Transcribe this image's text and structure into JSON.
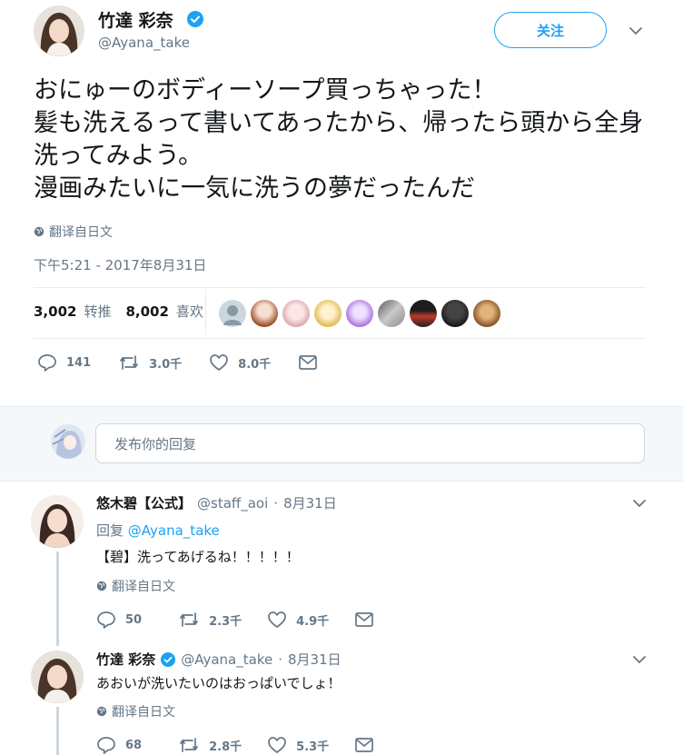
{
  "main_tweet": {
    "author_name": "竹達 彩奈",
    "author_handle": "@Ayana_take",
    "follow_label": "关注",
    "text_lines": [
      "おにゅーのボディーソープ買っちゃった！",
      "髪も洗えるって書いてあったから、帰ったら頭から全身",
      "洗ってみよう。",
      "漫画みたいに一気に洗うの夢だったんだ"
    ],
    "translate_label": "翻译自日文",
    "timestamp": "下午5:21 - 2017年8月31日",
    "retweet_count": "3,002",
    "retweet_label": "转推",
    "like_count": "8,002",
    "like_label": "喜欢",
    "actions": {
      "reply_count": "141",
      "retweet_count": "3.0千",
      "like_count": "8.0千"
    }
  },
  "composer": {
    "placeholder": "发布你的回复"
  },
  "replies": [
    {
      "author_name": "悠木碧【公式】",
      "author_handle": "@staff_aoi",
      "separator": "·",
      "date": "8月31日",
      "reply_to_label": "回复",
      "reply_to_handle": "@Ayana_take",
      "text": "【碧】洗ってあげるね！！！！！",
      "translate_label": "翻译自日文",
      "reply_count": "50",
      "retweet_count": "2.3千",
      "like_count": "4.9千"
    },
    {
      "author_name": "竹達 彩奈",
      "author_handle": "@Ayana_take",
      "separator": "·",
      "date": "8月31日",
      "text": "あおいが洗いたいのはおっぱいでしょ！",
      "translate_label": "翻译自日文",
      "reply_count": "68",
      "retweet_count": "2.8千",
      "like_count": "5.3千"
    }
  ],
  "colors": {
    "accent": "#1da1f2",
    "muted": "#657786",
    "border": "#e6ecf0",
    "band": "#f5f8fa"
  }
}
